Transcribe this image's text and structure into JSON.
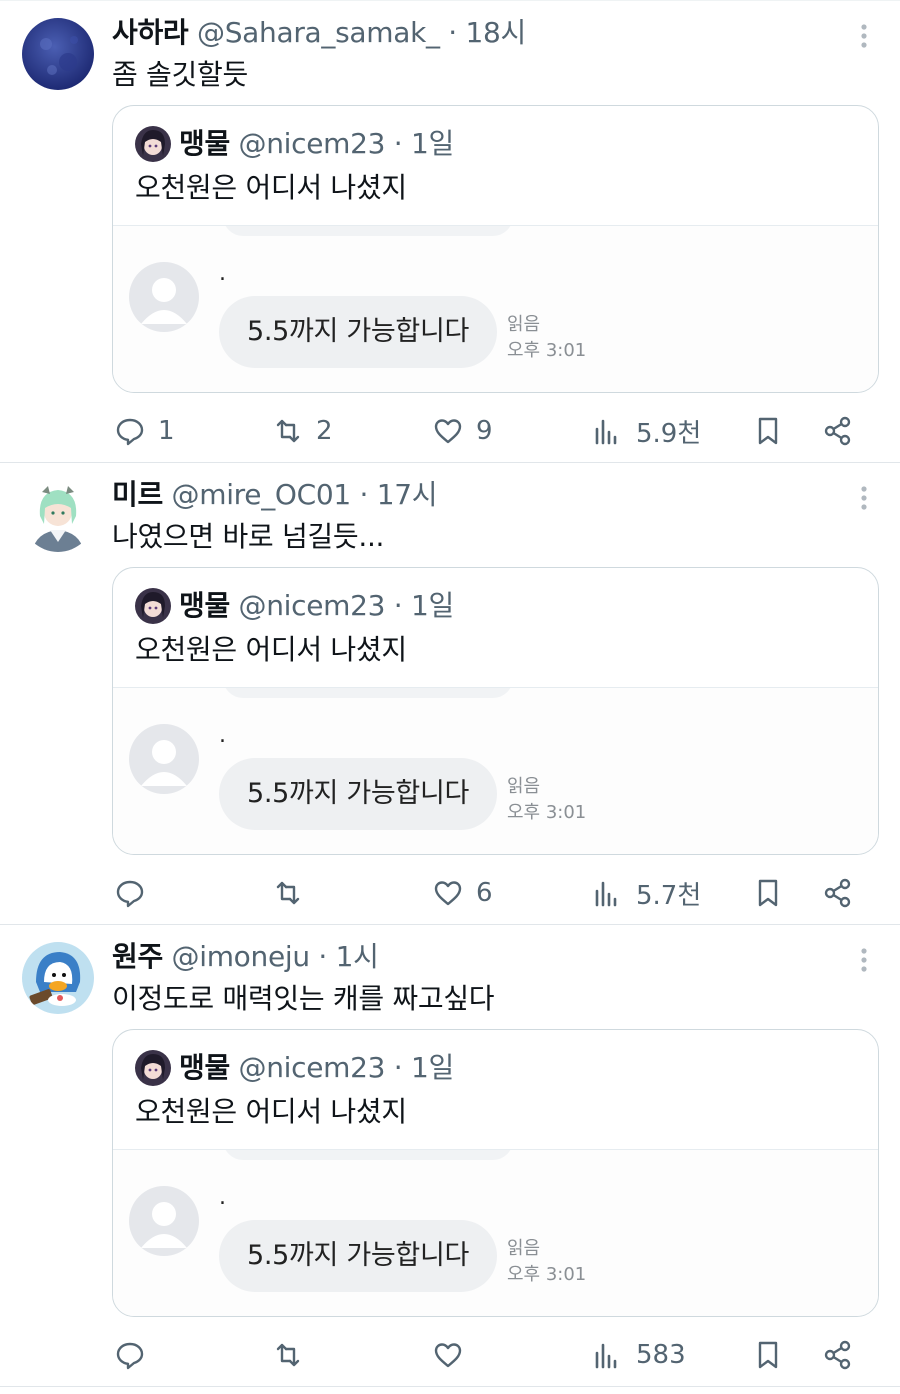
{
  "tweets": [
    {
      "author": {
        "name": "사하라",
        "handle": "@Sahara_samak_",
        "time": "18시",
        "avatar": "navy-texture-avatar"
      },
      "text": "좀 솔깃할듯",
      "quote": {
        "author": {
          "name": "맹물",
          "handle": "@nicem23",
          "time": "1일",
          "avatar": "anime-girl-avatar"
        },
        "text": "오천원은 어디서 나셨지",
        "chat": {
          "sender": ".",
          "message": "5.5까지 가능합니다",
          "read": "읽음",
          "time": "오후 3:01"
        }
      },
      "stats": {
        "replies": "1",
        "retweets": "2",
        "likes": "9",
        "views": "5.9천"
      }
    },
    {
      "author": {
        "name": "미르",
        "handle": "@mire_OC01",
        "time": "17시",
        "avatar": "green-hair-character-avatar"
      },
      "text": "나였으면 바로 넘길듯...",
      "quote": {
        "author": {
          "name": "맹물",
          "handle": "@nicem23",
          "time": "1일",
          "avatar": "anime-girl-avatar"
        },
        "text": "오천원은 어디서 나셨지",
        "chat": {
          "sender": ".",
          "message": "5.5까지 가능합니다",
          "read": "읽음",
          "time": "오후 3:01"
        }
      },
      "stats": {
        "replies": "",
        "retweets": "",
        "likes": "6",
        "views": "5.7천"
      }
    },
    {
      "author": {
        "name": "원주",
        "handle": "@imoneju",
        "time": "1시",
        "avatar": "duck-character-avatar"
      },
      "text": "이정도로 매력잇는 캐를 짜고싶다",
      "quote": {
        "author": {
          "name": "맹물",
          "handle": "@nicem23",
          "time": "1일",
          "avatar": "anime-girl-avatar"
        },
        "text": "오천원은 어디서 나셨지",
        "chat": {
          "sender": ".",
          "message": "5.5까지 가능합니다",
          "read": "읽음",
          "time": "오후 3:01"
        }
      },
      "stats": {
        "replies": "",
        "retweets": "",
        "likes": "",
        "views": "583"
      }
    }
  ],
  "separator": " · ",
  "icons": {
    "reply": "reply-icon",
    "retweet": "retweet-icon",
    "like": "heart-icon",
    "views": "views-chart-icon",
    "bookmark": "bookmark-icon",
    "share": "share-icon",
    "more": "more-vertical-icon"
  },
  "colors": {
    "text": "#0f1419",
    "muted": "#536471",
    "border": "#cfd9de",
    "bubble": "#eef0f2"
  }
}
